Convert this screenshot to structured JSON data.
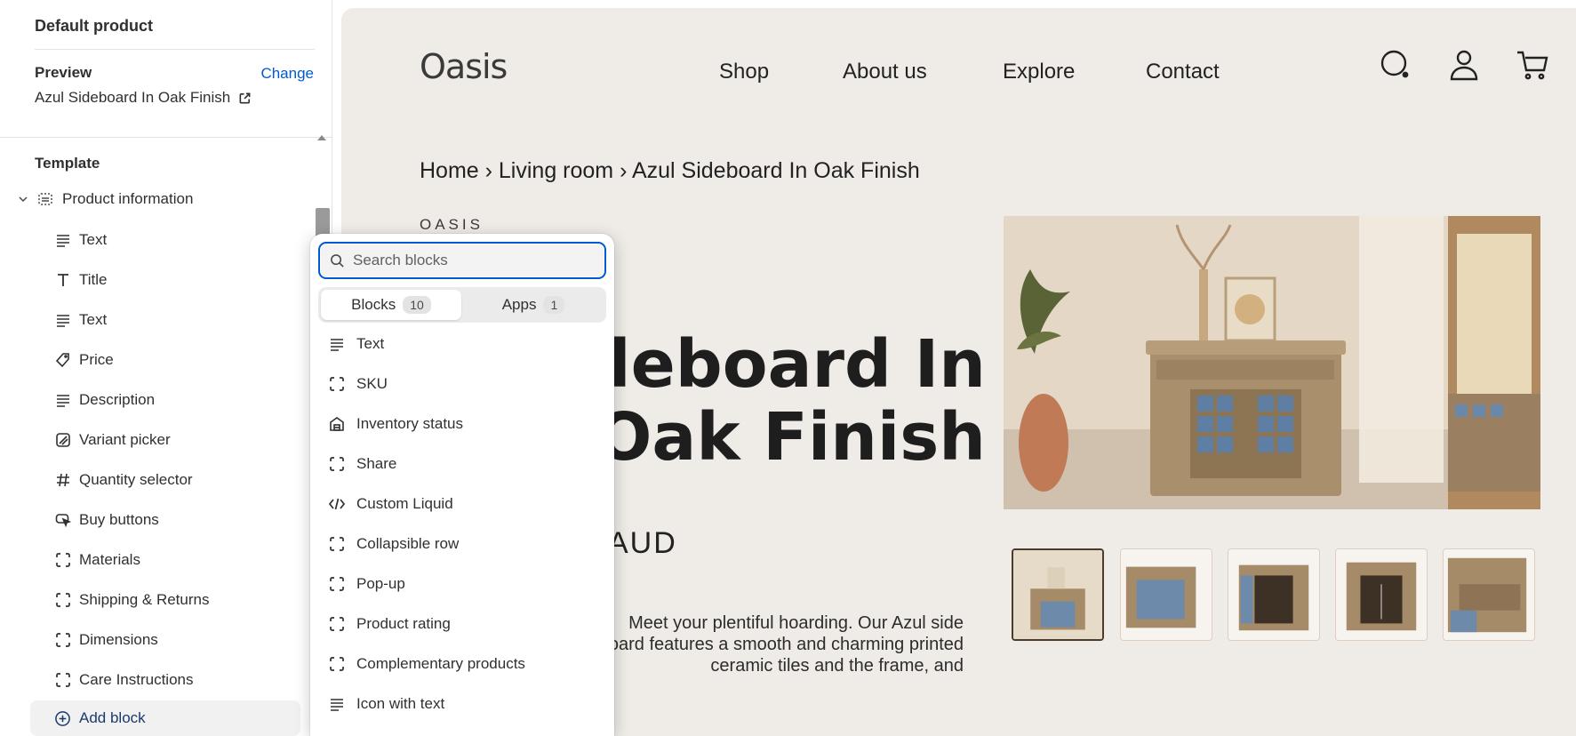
{
  "sidebar": {
    "title": "Default product",
    "preview_label": "Preview",
    "change_label": "Change",
    "product_name": "Azul Sideboard In Oak Finish",
    "template_label": "Template",
    "section_label": "Product information",
    "items": [
      {
        "label": "Text",
        "icon": "text-lines-icon"
      },
      {
        "label": "Title",
        "icon": "title-t-icon"
      },
      {
        "label": "Text",
        "icon": "text-lines-icon"
      },
      {
        "label": "Price",
        "icon": "price-tag-icon"
      },
      {
        "label": "Description",
        "icon": "text-lines-icon"
      },
      {
        "label": "Variant picker",
        "icon": "variant-icon"
      },
      {
        "label": "Quantity selector",
        "icon": "hash-icon"
      },
      {
        "label": "Buy buttons",
        "icon": "cursor-click-icon"
      },
      {
        "label": "Materials",
        "icon": "dashed-square-icon"
      },
      {
        "label": "Shipping & Returns",
        "icon": "dashed-square-icon"
      },
      {
        "label": "Dimensions",
        "icon": "dashed-square-icon"
      },
      {
        "label": "Care Instructions",
        "icon": "dashed-square-icon"
      }
    ],
    "add_block_label": "Add block"
  },
  "store": {
    "logo": "Oasis",
    "nav": [
      "Shop",
      "About us",
      "Explore",
      "Contact"
    ],
    "breadcrumb": "Home › Living room › Azul Sideboard In Oak Finish",
    "vendor": "OASIS",
    "title_line1": "Azul Sideboard In",
    "title_line2": "Oak Finish",
    "price": "AUD",
    "description_lines": [
      "Meet your plentiful hoarding. Our Azul side",
      "board features a smooth and charming printed",
      "ceramic tiles and the frame, and"
    ]
  },
  "popover": {
    "search_placeholder": "Search blocks",
    "tabs": [
      {
        "label": "Blocks",
        "count": "10"
      },
      {
        "label": "Apps",
        "count": "1"
      }
    ],
    "blocks": [
      {
        "label": "Text",
        "icon": "text-lines-icon"
      },
      {
        "label": "SKU",
        "icon": "dashed-square-icon"
      },
      {
        "label": "Inventory status",
        "icon": "inventory-icon"
      },
      {
        "label": "Share",
        "icon": "dashed-square-icon"
      },
      {
        "label": "Custom Liquid",
        "icon": "code-icon"
      },
      {
        "label": "Collapsible row",
        "icon": "dashed-square-icon"
      },
      {
        "label": "Pop-up",
        "icon": "dashed-square-icon"
      },
      {
        "label": "Product rating",
        "icon": "dashed-square-icon"
      },
      {
        "label": "Complementary products",
        "icon": "dashed-square-icon"
      },
      {
        "label": "Icon with text",
        "icon": "text-lines-icon"
      }
    ]
  },
  "colors": {
    "accent": "#005bd3",
    "store_bg": "#efebe6"
  }
}
